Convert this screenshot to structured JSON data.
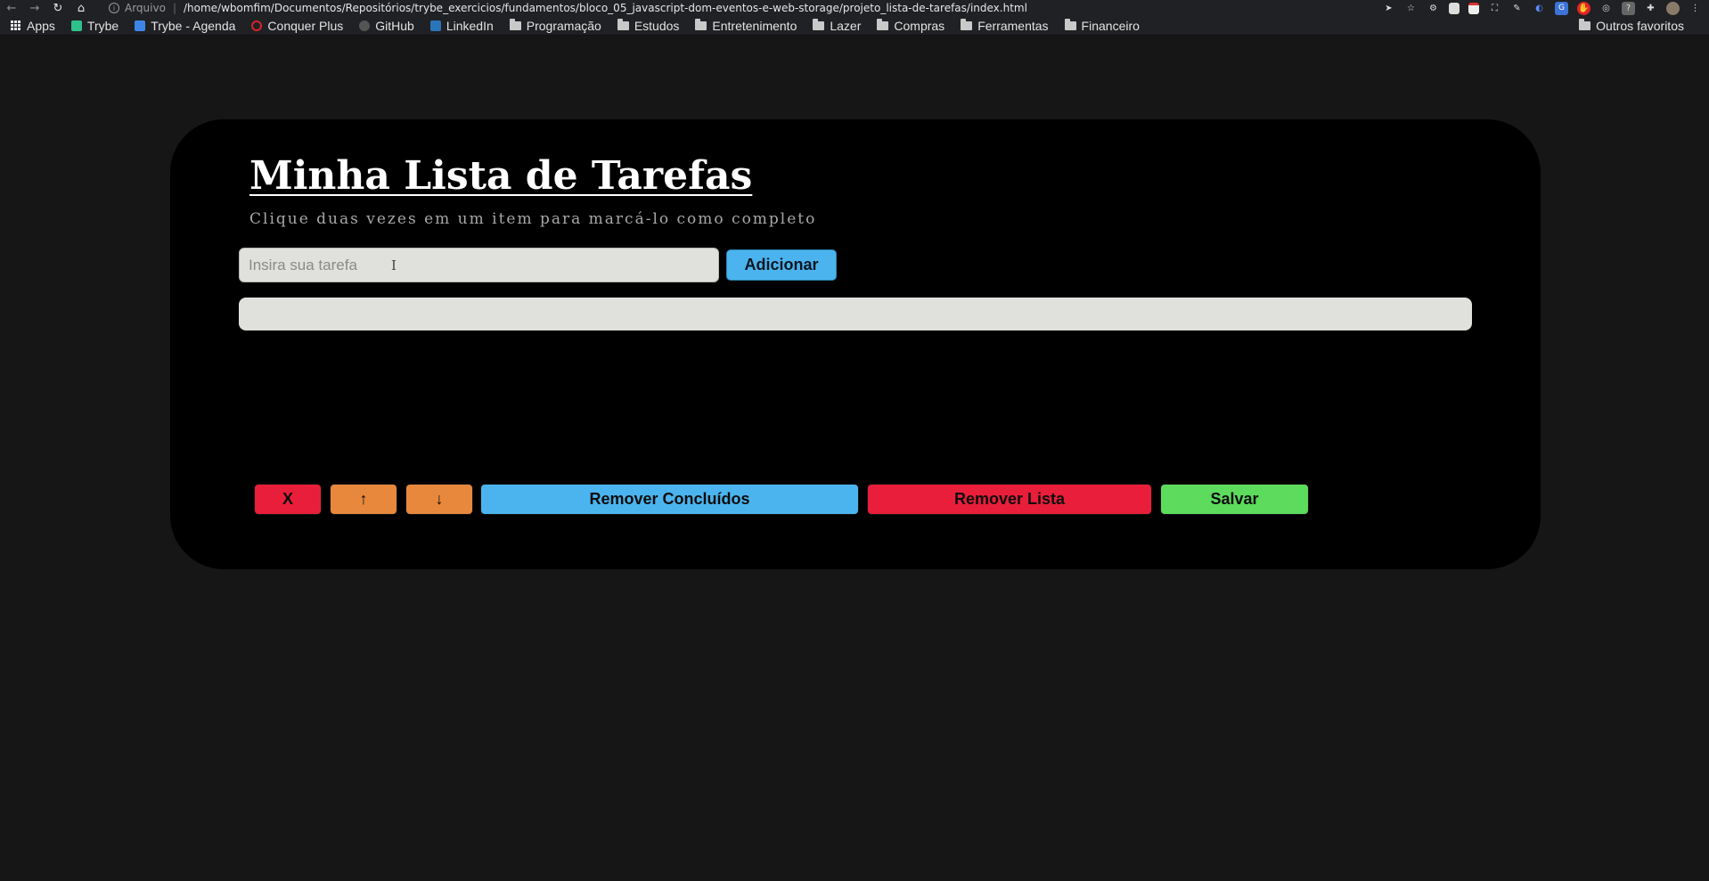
{
  "browser": {
    "site_label": "Arquivo",
    "url": "/home/wbomfim/Documentos/Repositórios/trybe_exercicios/fundamentos/bloco_05_javascript-dom-eventos-e-web-storage/projeto_lista-de-tarefas/index.html",
    "bookmarks": [
      {
        "label": "Apps",
        "icon": "apps-grid-icon"
      },
      {
        "label": "Trybe",
        "icon": "trybe-icon"
      },
      {
        "label": "Trybe - Agenda",
        "icon": "calendar-icon"
      },
      {
        "label": "Conquer Plus",
        "icon": "conquer-icon"
      },
      {
        "label": "GitHub",
        "icon": "github-icon"
      },
      {
        "label": "LinkedIn",
        "icon": "linkedin-icon"
      },
      {
        "label": "Programação",
        "icon": "folder-icon"
      },
      {
        "label": "Estudos",
        "icon": "folder-icon"
      },
      {
        "label": "Entretenimento",
        "icon": "folder-icon"
      },
      {
        "label": "Lazer",
        "icon": "folder-icon"
      },
      {
        "label": "Compras",
        "icon": "folder-icon"
      },
      {
        "label": "Ferramentas",
        "icon": "folder-icon"
      },
      {
        "label": "Financeiro",
        "icon": "folder-icon"
      }
    ],
    "other_bookmarks": "Outros favoritos"
  },
  "app": {
    "title": "Minha Lista de Tarefas",
    "subtitle": "Clique duas vezes em um item para marcá-lo como completo",
    "input_placeholder": "Insira sua tarefa",
    "input_value": "",
    "add_label": "Adicionar",
    "tasks": [],
    "controls": {
      "remove_selected": "X",
      "move_up": "↑",
      "move_down": "↓",
      "remove_done": "Remover Concluídos",
      "clear_list": "Remover Lista",
      "save": "Salvar"
    }
  },
  "colors": {
    "page_bg": "#161616",
    "card_bg": "#000000",
    "blue": "#4bb4ef",
    "red": "#e91e3a",
    "orange": "#e8883d",
    "green": "#5cdb5c"
  }
}
